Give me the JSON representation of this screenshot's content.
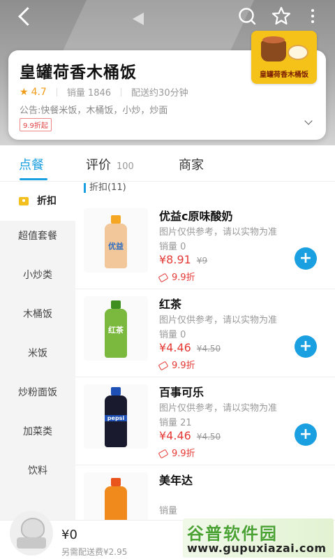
{
  "store": {
    "name": "皇罐荷香木桶饭",
    "logo_text": "皇罐荷香木桶饭",
    "rating": "4.7",
    "sales": "销量 1846",
    "delivery_time": "配送约30分钟",
    "notice": "公告:快餐米饭，木桶饭，小炒，炒面",
    "discount_tag": "9.9折起"
  },
  "tabs": [
    {
      "label": "点餐",
      "count": ""
    },
    {
      "label": "评价",
      "count": "100"
    },
    {
      "label": "商家",
      "count": ""
    }
  ],
  "categories": [
    "折扣",
    "超值套餐",
    "小炒类",
    "木桶饭",
    "米饭",
    "炒粉面饭",
    "加菜类",
    "饮料"
  ],
  "section_title": "折扣(11)",
  "items": [
    {
      "name": "优益c原味酸奶",
      "desc": "图片仅供参考，请以实物为准",
      "sales": "销量 0",
      "price": "¥8.91",
      "orig_price": "¥9",
      "discount": "9.9折",
      "img_label": "优益"
    },
    {
      "name": "红茶",
      "desc": "图片仅供参考，请以实物为准",
      "sales": "销量 0",
      "price": "¥4.46",
      "orig_price": "¥4.50",
      "discount": "9.9折",
      "img_label": "红茶"
    },
    {
      "name": "百事可乐",
      "desc": "图片仅供参考，请以实物为准",
      "sales": "销量 21",
      "price": "¥4.46",
      "orig_price": "¥4.50",
      "discount": "9.9折",
      "img_label": "pepsi"
    },
    {
      "name": "美年达",
      "desc": "",
      "sales": "销量",
      "price": "",
      "orig_price": "",
      "discount": "",
      "img_label": ""
    }
  ],
  "cart": {
    "amount": "¥0",
    "delivery_note": "另需配送费¥2.95"
  },
  "watermark": {
    "title": "谷普软件园",
    "url": "www.gupuxiazai.com"
  },
  "colors": {
    "accent": "#1a9fe0",
    "price": "#e53935",
    "rating": "#f09b1a"
  }
}
